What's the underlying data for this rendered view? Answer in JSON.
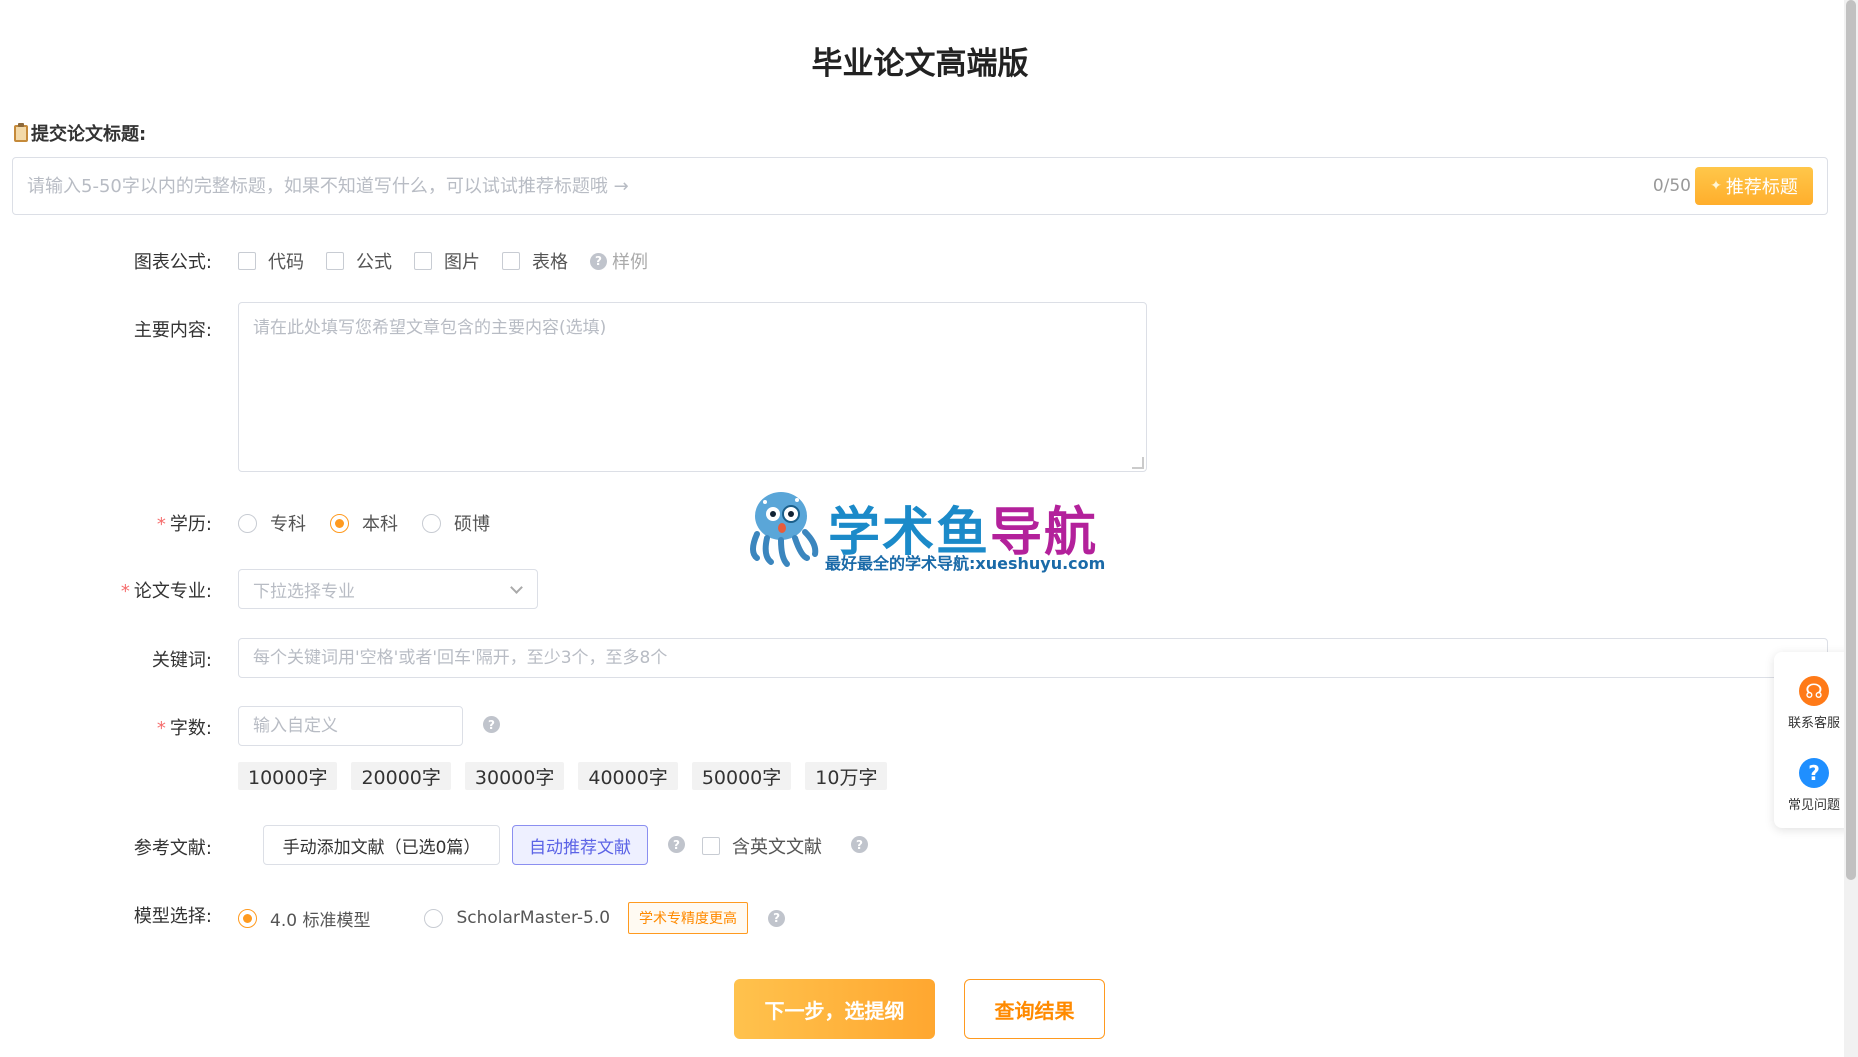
{
  "page": {
    "title": "毕业论文高端版"
  },
  "title_section": {
    "label": "提交论文标题:",
    "placeholder": "请输入5-50字以内的完整标题，如果不知道写什么，可以试试推荐标题哦 →",
    "value": "",
    "count": "0/50",
    "recommend_button": "推荐标题"
  },
  "charts": {
    "label": "图表公式:",
    "options": [
      "代码",
      "公式",
      "图片",
      "表格"
    ],
    "sample_link": "样例"
  },
  "content": {
    "label": "主要内容:",
    "placeholder": "请在此处填写您希望文章包含的主要内容(选填)"
  },
  "education": {
    "label": "学历:",
    "options": [
      "专科",
      "本科",
      "硕博"
    ],
    "selected": "本科"
  },
  "major": {
    "label": "论文专业:",
    "placeholder": "下拉选择专业"
  },
  "keywords": {
    "label": "关键词:",
    "placeholder": "每个关键词用'空格'或者'回车'隔开，至少3个，至多8个"
  },
  "word_count": {
    "label": "字数:",
    "placeholder": "输入自定义",
    "presets": [
      "10000字",
      "20000字",
      "30000字",
      "40000字",
      "50000字",
      "10万字"
    ]
  },
  "references": {
    "label": "参考文献:",
    "manual_button": "手动添加文献（已选0篇）",
    "auto_button": "自动推荐文献",
    "english_option": "含英文文献"
  },
  "model": {
    "label": "模型选择:",
    "options": [
      "4.0 标准模型",
      "ScholarMaster-5.0"
    ],
    "selected": "4.0 标准模型",
    "tag": "学术专精度更高"
  },
  "actions": {
    "next_button": "下一步，选提纲",
    "query_button": "查询结果"
  },
  "watermark": {
    "title_part1": "学术鱼",
    "title_part2": "导航",
    "subtitle": "最好最全的学术导航:xueshuyu.com"
  },
  "side_panel": {
    "service_label": "联系客服",
    "faq_label": "常见问题"
  },
  "colors": {
    "accent": "#ff9a1f",
    "primary_button": "#ffb23a",
    "required": "#f56c6c",
    "auto_ref": "#5b63e6"
  }
}
